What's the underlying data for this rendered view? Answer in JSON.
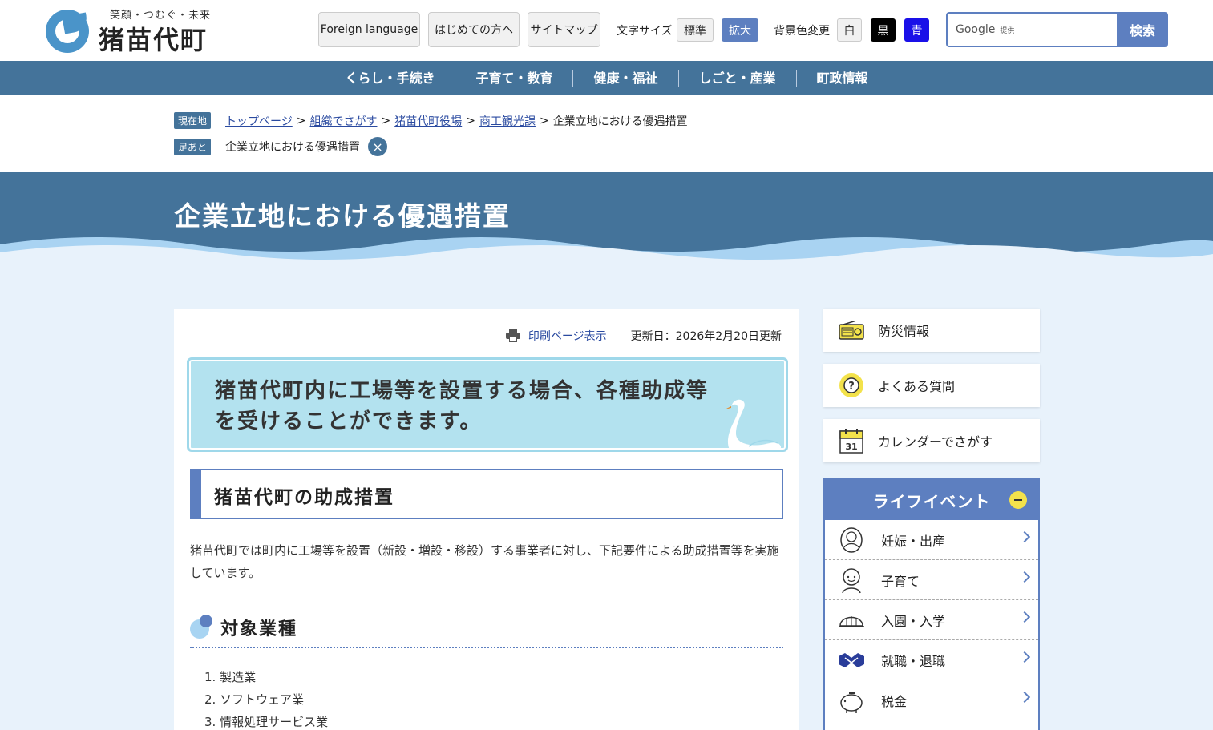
{
  "header": {
    "tagline": "笑顔・つむぐ・未来",
    "site_name": "猪苗代町",
    "foreign_language": "Foreign language",
    "first_time": "はじめての方へ",
    "sitemap": "サイトマップ",
    "font_size_label": "文字サイズ",
    "font_standard": "標準",
    "font_large": "拡大",
    "bg_label": "背景色変更",
    "bg_white": "白",
    "bg_black": "黒",
    "bg_blue": "青",
    "search_brand": "Google",
    "search_brand_suffix": "提供",
    "search_button": "検索"
  },
  "nav": [
    "くらし・手続き",
    "子育て・教育",
    "健康・福祉",
    "しごと・産業",
    "町政情報"
  ],
  "breadcrumb": {
    "current_tag": "現在地",
    "trail": [
      "トップページ",
      "組織でさがす",
      "猪苗代町役場",
      "商工観光課"
    ],
    "sep": ">",
    "current": "企業立地における優遇措置",
    "history_tag": "足あと",
    "history_item": "企業立地における優遇措置"
  },
  "page": {
    "title": "企業立地における優遇措置",
    "print_link": "印刷ページ表示",
    "updated": "更新日：2026年2月20日更新",
    "lead": "猪苗代町内に工場等を設置する場合、各種助成等を受けることができます。",
    "h2": "猪苗代町の助成措置",
    "para": "猪苗代町では町内に工場等を設置（新設・増設・移設）する事業者に対し、下記要件による助成措置等を実施しています。",
    "h3": "対象業種",
    "list": [
      "1. 製造業",
      "2. ソフトウェア業",
      "3. 情報処理サービス業"
    ]
  },
  "sidebar": {
    "disaster": "防災情報",
    "faq": "よくある質問",
    "calendar": "カレンダーでさがす",
    "calendar_day": "31",
    "life_title": "ライフイベント",
    "life_items": [
      "妊娠・出産",
      "子育て",
      "入園・入学",
      "就職・退職",
      "税金"
    ]
  },
  "colors": {
    "nav_bg": "#44739a",
    "accent": "#5d7fc0",
    "lead_bg": "#b3e2ef",
    "page_bg": "#e8f2fb"
  }
}
